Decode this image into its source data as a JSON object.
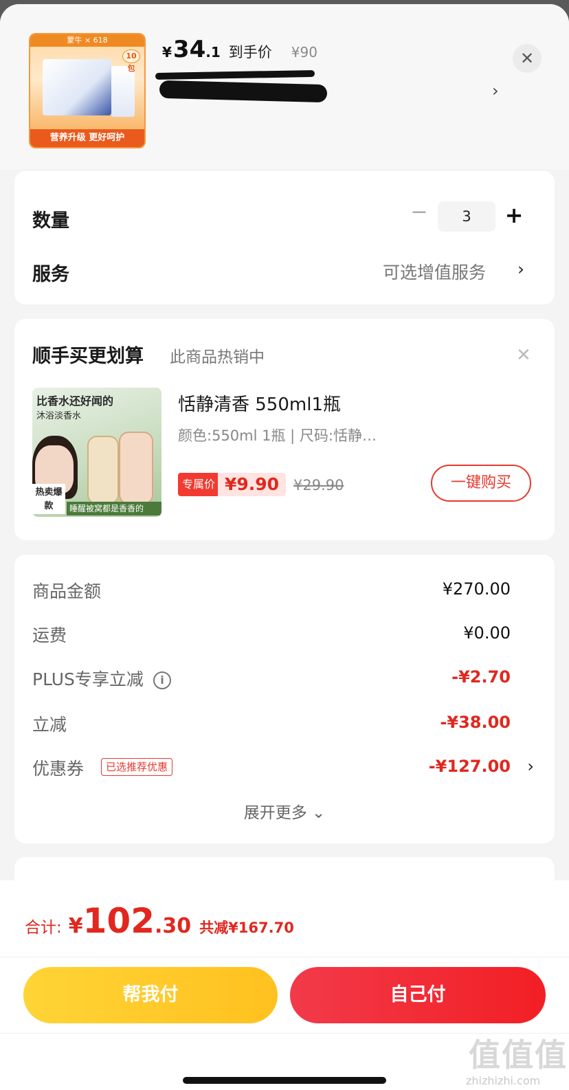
{
  "header": {
    "thumb_top_text": "蒙牛 × 618",
    "thumb_badge": "10包",
    "thumb_bottom_text": "营养升级 更好呵护",
    "price_currency": "¥",
    "price_int": "34",
    "price_dec": ".1",
    "price_tag": "到手价",
    "price_original": "¥90",
    "close_glyph": "✕",
    "chevron_glyph": "›"
  },
  "options": {
    "quantity_label": "数量",
    "quantity_minus": "−",
    "quantity_value": "3",
    "quantity_plus": "+",
    "service_label": "服务",
    "service_value": "可选增值服务",
    "service_chevron": "›"
  },
  "upsell": {
    "title": "顺手买更划算",
    "subtitle": "此商品热销中",
    "close_glyph": "✕",
    "image_text_1": "比香水还好闻的",
    "image_text_2": "沐浴淡香水",
    "image_hot": "热卖爆款",
    "image_bottom": "睡醒被窝都是香香的",
    "name": "恬静清香 550ml1瓶",
    "spec": "颜色:550ml 1瓶  |  尺码:恬静…",
    "exclusive_tag": "专属价",
    "exclusive_price": "¥9.90",
    "original_price": "¥29.90",
    "buy_button": "一键购买"
  },
  "fees": {
    "items": [
      {
        "label": "商品金额",
        "value": "¥270.00"
      },
      {
        "label": "运费",
        "value": "¥0.00"
      },
      {
        "label": "PLUS专享立减",
        "value": "-¥2.70"
      },
      {
        "label": "立减",
        "value": "-¥38.00"
      },
      {
        "label": "优惠券",
        "value": "-¥127.00"
      }
    ],
    "info_glyph": "i",
    "coupon_tag": "已选推荐优惠",
    "coupon_chevron": "›",
    "expand_more": "展开更多 ⌄"
  },
  "footer": {
    "total_label": "合计:",
    "total_currency": "¥",
    "total_int": "102",
    "total_dec": ".30",
    "total_saved": "共减¥167.70",
    "help_pay_button": "帮我付",
    "self_pay_button": "自己付",
    "watermark": "值值值",
    "watermark_url": "zhizhizhi.com"
  },
  "colors": {
    "accent_red": "#e0281f",
    "help_yellow": "#ffc11f",
    "pay_red": "#f21f24"
  }
}
